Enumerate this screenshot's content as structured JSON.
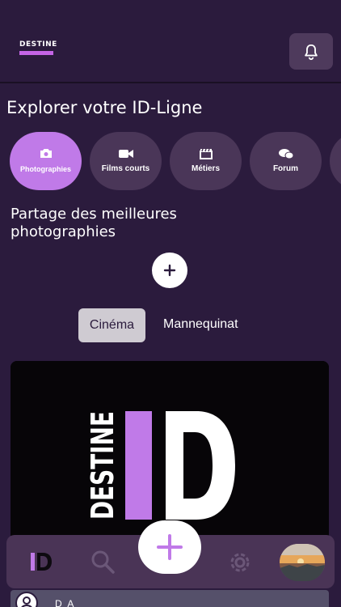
{
  "header": {
    "logo_text": "DESTINE",
    "notification_icon": "bell-icon"
  },
  "explore": {
    "title": "Explorer votre ID-Ligne"
  },
  "categories": [
    {
      "label": "Photographies",
      "icon": "camera-icon",
      "active": true
    },
    {
      "label": "Films courts",
      "icon": "video-icon",
      "active": false
    },
    {
      "label": "Métiers",
      "icon": "clapperboard-icon",
      "active": false
    },
    {
      "label": "Forum",
      "icon": "chat-bubbles-icon",
      "active": false
    }
  ],
  "share": {
    "title": "Partage des meilleures photographies",
    "add_icon": "plus-icon"
  },
  "tabs": [
    {
      "label": "Cinéma",
      "selected": true
    },
    {
      "label": "Mannequinat",
      "selected": false
    }
  ],
  "post": {
    "image_brand_vertical": "DESTINE",
    "image_brand_big": "ID",
    "author_initials": "D A"
  },
  "bottom_nav": {
    "items": [
      "home-id-logo-icon",
      "search-icon",
      "add-post-icon",
      "settings-gear-icon",
      "profile-avatar"
    ]
  },
  "colors": {
    "background": "#2b1b3d",
    "accent": "#c07ae8",
    "pill": "#4a3658",
    "nav": "#4a3456"
  }
}
